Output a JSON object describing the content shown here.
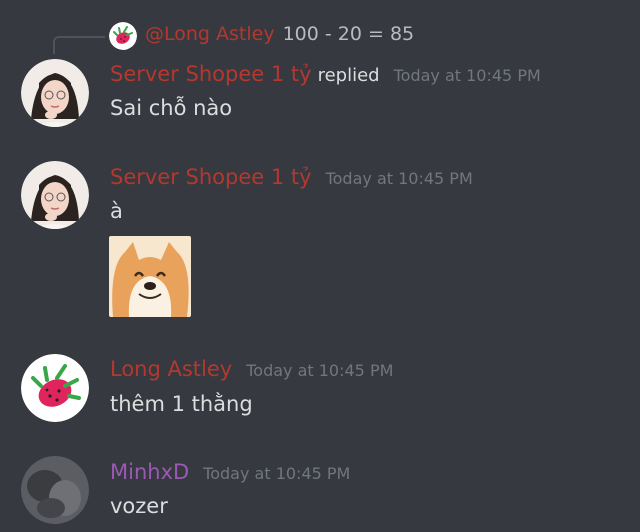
{
  "colors": {
    "background": "#36393f",
    "server_shopee_name": "#b5382f",
    "long_astley_name": "#b5382f",
    "minhxd_name": "#9b59b6",
    "timestamp": "#72767d",
    "text": "#dcddde"
  },
  "reply_preview": {
    "author": "@Long Astley",
    "text": "100 - 20 = 85",
    "avatar_icon": "dragon-fruit-icon"
  },
  "messages": [
    {
      "author": "Server Shopee 1 tỷ",
      "replied_label": "replied",
      "timestamp": "Today at 10:45 PM",
      "content": "Sai chỗ nào",
      "avatar_icon": "girl-portrait-avatar"
    },
    {
      "author": "Server Shopee 1 tỷ",
      "timestamp": "Today at 10:45 PM",
      "content": "à",
      "sticker": "shiba-dog-sticker",
      "avatar_icon": "girl-portrait-avatar"
    },
    {
      "author": "Long Astley",
      "timestamp": "Today at 10:45 PM",
      "content": "thêm 1 thằng",
      "avatar_icon": "dragon-fruit-icon"
    },
    {
      "author": "MinhxD",
      "timestamp": "Today at 10:45 PM",
      "content": "vozer",
      "avatar_icon": "dark-photo-avatar"
    }
  ]
}
